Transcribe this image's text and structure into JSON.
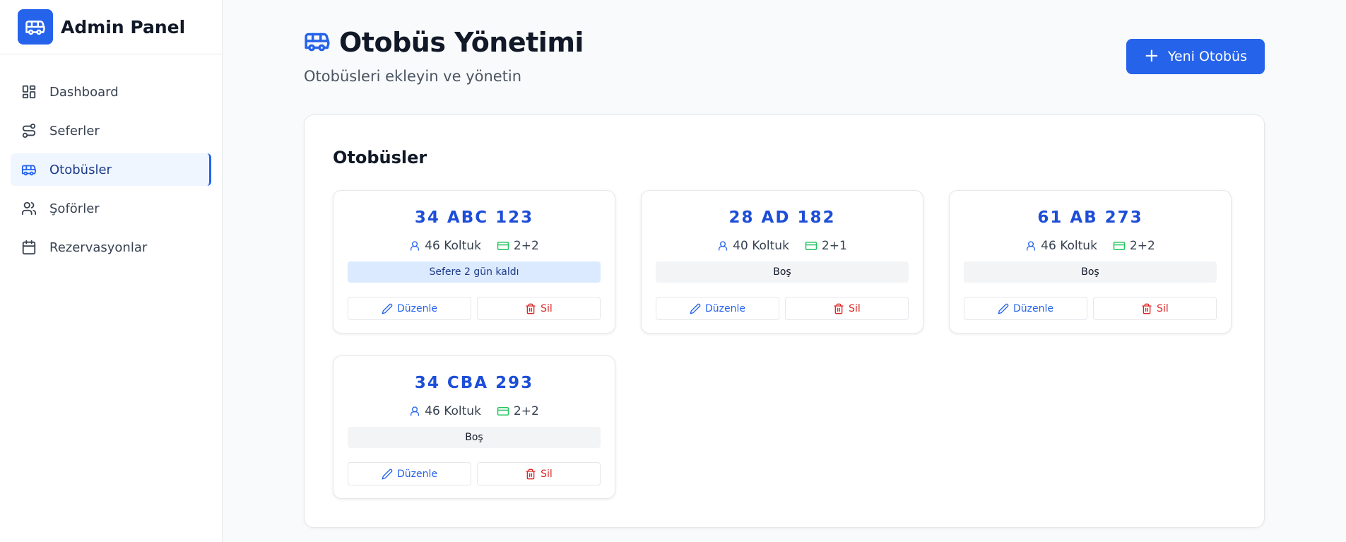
{
  "brand": {
    "title": "Admin Panel",
    "logo_icon": "bus-icon"
  },
  "sidebar": {
    "items": [
      {
        "label": "Dashboard",
        "icon": "dashboard-grid-icon"
      },
      {
        "label": "Seferler",
        "icon": "route-icon"
      },
      {
        "label": "Otobüsler",
        "icon": "bus-icon",
        "active": true
      },
      {
        "label": "Şoförler",
        "icon": "users-icon"
      },
      {
        "label": "Rezervasyonlar",
        "icon": "calendar-icon"
      }
    ]
  },
  "header": {
    "title": "Otobüs Yönetimi",
    "subtitle": "Otobüsleri ekleyin ve yönetin",
    "new_button": "Yeni Otobüs"
  },
  "panel": {
    "title": "Otobüsler",
    "buses": [
      {
        "plate": "34 ABC 123",
        "seats": "46 Koltuk",
        "layout": "2+2",
        "status": "Sefere 2 gün kaldı",
        "status_type": "upcoming",
        "edit_label": "Düzenle",
        "delete_label": "Sil"
      },
      {
        "plate": "28 AD 182",
        "seats": "40 Koltuk",
        "layout": "2+1",
        "status": "Boş",
        "status_type": "idle",
        "edit_label": "Düzenle",
        "delete_label": "Sil"
      },
      {
        "plate": "61 AB 273",
        "seats": "46 Koltuk",
        "layout": "2+2",
        "status": "Boş",
        "status_type": "idle",
        "edit_label": "Düzenle",
        "delete_label": "Sil"
      },
      {
        "plate": "34 CBA 293",
        "seats": "46 Koltuk",
        "layout": "2+2",
        "status": "Boş",
        "status_type": "idle",
        "edit_label": "Düzenle",
        "delete_label": "Sil"
      }
    ]
  },
  "colors": {
    "accent": "#2563eb",
    "plate": "#1d4ed8",
    "danger": "#dc2626",
    "layout_icon": "#22c55e",
    "upcoming_bg": "#dbeafe",
    "idle_bg": "#f3f4f6"
  }
}
